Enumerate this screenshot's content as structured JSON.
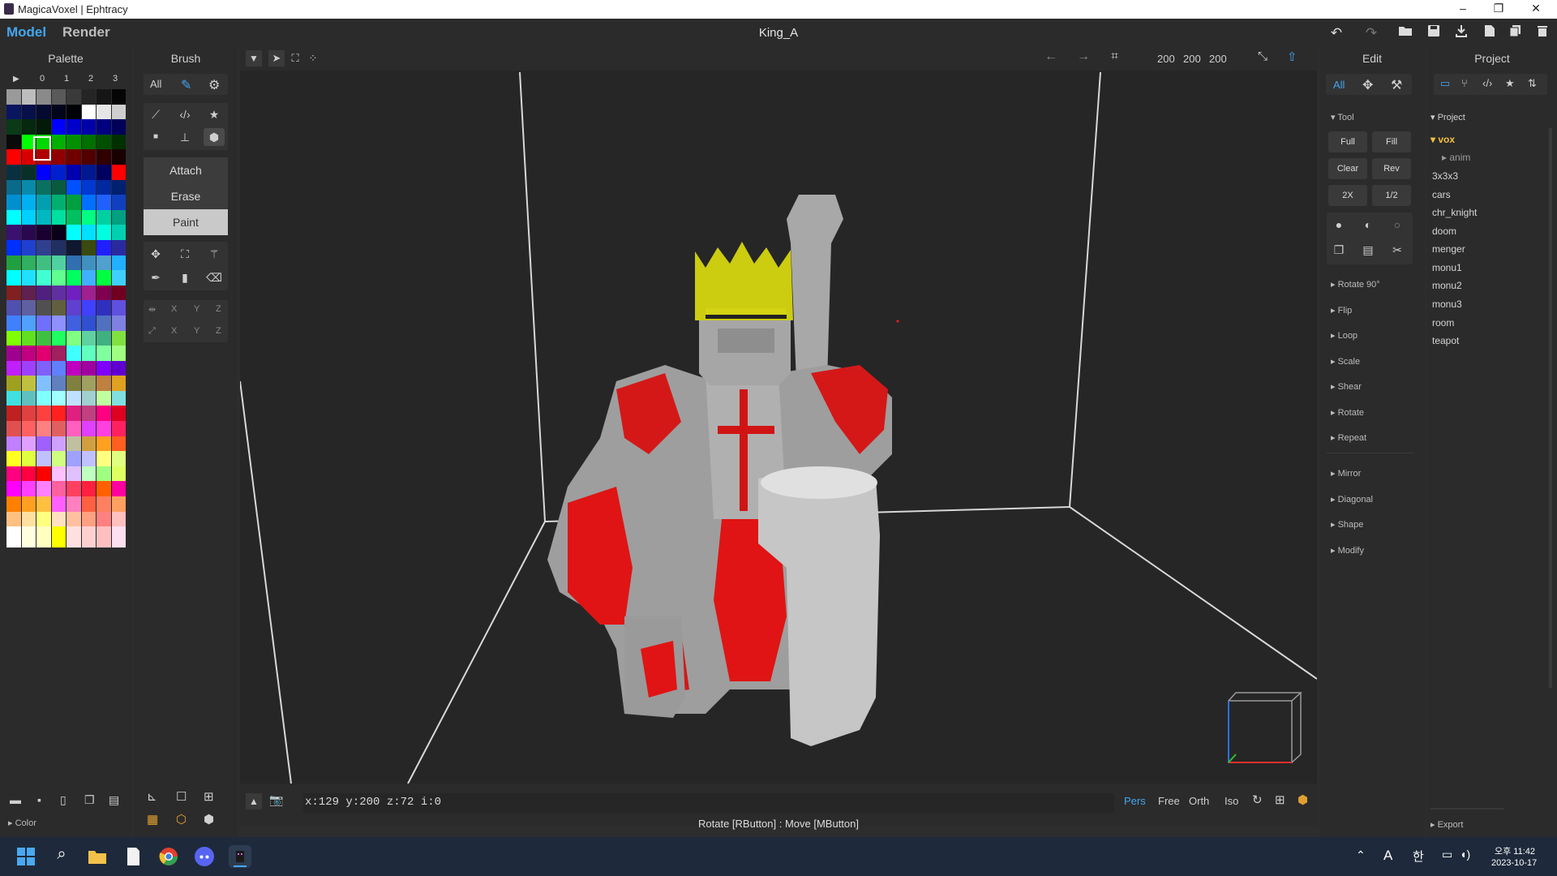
{
  "window": {
    "title": "MagicaVoxel | Ephtracy",
    "minimize": "–",
    "restore": "❐",
    "close": "✕"
  },
  "topbar": {
    "mode_model": "Model",
    "mode_render": "Render",
    "filename": "King_A"
  },
  "palette": {
    "title": "Palette",
    "pages": [
      "0",
      "1",
      "2",
      "3"
    ],
    "footer_label": "Color",
    "colors": [
      "#9a9a9a",
      "#bdbdbd",
      "#8a8a8a",
      "#5a5a5a",
      "#3a3a3a",
      "#252525",
      "#161616",
      "#050505",
      "#0a1560",
      "#08104a",
      "#050a30",
      "#03061a",
      "#010208",
      "#ffffff",
      "#e6e6e6",
      "#cfcfcf",
      "#0a3a18",
      "#06280f",
      "#041a08",
      "#0000ff",
      "#0000cc",
      "#0000a8",
      "#000080",
      "#00005a",
      "#0a0a0a",
      "#00ff00",
      "#00d800",
      "#00b000",
      "#009000",
      "#007000",
      "#005000",
      "#003000",
      "#ff0000",
      "#d80000",
      "#b00000",
      "#900000",
      "#700000",
      "#500000",
      "#300000",
      "#180000",
      "#0a3040",
      "#083028",
      "#0000ff",
      "#0020d0",
      "#0000b0",
      "#001890",
      "#000060",
      "#ff0000",
      "#0a6a8a",
      "#0a8aaa",
      "#0a7060",
      "#0a5a40",
      "#0050ff",
      "#0038d0",
      "#0028a0",
      "#002070",
      "#0090d0",
      "#00b0f0",
      "#00a0b0",
      "#00b070",
      "#00a040",
      "#0070ff",
      "#2060ff",
      "#1040c0",
      "#00ffff",
      "#00d0ff",
      "#00b8c0",
      "#00e0a0",
      "#00c060",
      "#00ff80",
      "#00d0a0",
      "#00a080",
      "#3a1070",
      "#2a0850",
      "#1a0030",
      "#0a0018",
      "#00ffff",
      "#00e0ff",
      "#00ffe0",
      "#00d0b0",
      "#0030ff",
      "#2040d0",
      "#304090",
      "#203060",
      "#101830",
      "#3a4a10",
      "#2020ff",
      "#2a2aa0",
      "#20a040",
      "#30b060",
      "#40c080",
      "#50d0a0",
      "#3070b0",
      "#4090c0",
      "#50a0d0",
      "#20b0ff",
      "#00ffff",
      "#20e0ff",
      "#40ffd0",
      "#60ff90",
      "#00ff60",
      "#40b0ff",
      "#00ff40",
      "#40d0ff",
      "#802020",
      "#602050",
      "#502080",
      "#6030a0",
      "#7020c0",
      "#a02090",
      "#800050",
      "#700020",
      "#5050b0",
      "#6060a0",
      "#505050",
      "#606040",
      "#6040d0",
      "#4040ff",
      "#3030c0",
      "#6050e0",
      "#4080ff",
      "#50a0ff",
      "#7070ff",
      "#9090ff",
      "#4060e0",
      "#3050d0",
      "#5070c0",
      "#8080e0",
      "#80ff00",
      "#60e020",
      "#40c040",
      "#20ff60",
      "#80ff80",
      "#60d0a0",
      "#40b080",
      "#80e040",
      "#a00090",
      "#c00080",
      "#e00070",
      "#a02060",
      "#40ffff",
      "#60ffc0",
      "#80ffa0",
      "#a0ff80",
      "#c020ff",
      "#a040ff",
      "#8060ff",
      "#6080ff",
      "#c000c0",
      "#a000a0",
      "#8000ff",
      "#6000d0",
      "#a0a020",
      "#c0c040",
      "#80c0ff",
      "#6080c0",
      "#808040",
      "#a0a060",
      "#c08040",
      "#e0a020",
      "#40e0e0",
      "#60c0c0",
      "#80ffff",
      "#a0ffff",
      "#c0e0ff",
      "#a0d0d0",
      "#c0ffa0",
      "#80e0e0",
      "#c02020",
      "#e04040",
      "#ff4040",
      "#ff2020",
      "#e02080",
      "#c04080",
      "#ff0080",
      "#e00020",
      "#e05050",
      "#ff6060",
      "#ff8080",
      "#e06060",
      "#ff60c0",
      "#e040ff",
      "#ff40e0",
      "#ff2060",
      "#c080ff",
      "#e0a0ff",
      "#a060ff",
      "#d0a0ff",
      "#c0c0a0",
      "#d0a040",
      "#ffa020",
      "#ff6020",
      "#ffff20",
      "#e0ff40",
      "#c0c0ff",
      "#d0ff80",
      "#a0a0ff",
      "#c0c0ff",
      "#ffff80",
      "#e0ff80",
      "#ff0080",
      "#ff0040",
      "#ff0000",
      "#ffc0ff",
      "#e0c0ff",
      "#c0ffc0",
      "#a0ff80",
      "#e0ff60",
      "#ff00ff",
      "#ff40ff",
      "#ff80ff",
      "#ff60a0",
      "#ff4060",
      "#ff2040",
      "#ff6000",
      "#ff00a0",
      "#ff8000",
      "#ffa020",
      "#ffc040",
      "#ff60ff",
      "#ff80c0",
      "#ff6040",
      "#ff8060",
      "#ffa060",
      "#ffc080",
      "#ffe0a0",
      "#ffff80",
      "#ffe0c0",
      "#ffc0a0",
      "#ffa080",
      "#ff8080",
      "#ffc0c0",
      "#ffffff",
      "#ffffe0",
      "#ffffc0",
      "#ffff00",
      "#ffe0e0",
      "#ffd0d0",
      "#ffc0c0",
      "#ffe0f0"
    ]
  },
  "brush": {
    "title": "Brush",
    "filter_all": "All",
    "modes": [
      "Attach",
      "Erase",
      "Paint"
    ],
    "axes1": [
      "X",
      "Y",
      "Z"
    ],
    "axes2": [
      "X",
      "Y",
      "Z"
    ]
  },
  "viewport": {
    "dims": [
      "200",
      "200",
      "200"
    ],
    "coords": "x:129 y:200 z:72   i:0",
    "views": [
      "Pers",
      "Free",
      "Orth",
      "Iso"
    ],
    "active_view": "Pers",
    "hint": "Rotate [RButton] : Move [MButton]"
  },
  "edit": {
    "title": "Edit",
    "filter_all": "All",
    "tool_section": "Tool",
    "tool_buttons": [
      [
        "Full",
        "Fill"
      ],
      [
        "Clear",
        "Rev"
      ],
      [
        "2X",
        "1/2"
      ]
    ],
    "sections": [
      "Rotate 90°",
      "Flip",
      "Loop",
      "Scale",
      "Shear",
      "Rotate",
      "Repeat"
    ],
    "sections2": [
      "Mirror",
      "Diagonal",
      "Shape",
      "Modify"
    ]
  },
  "project": {
    "title": "Project",
    "root": "Project",
    "folder": "vox",
    "subfolder": "anim",
    "files": [
      "3x3x3",
      "cars",
      "chr_knight",
      "doom",
      "menger",
      "monu1",
      "monu2",
      "monu3",
      "room",
      "teapot"
    ],
    "export": "Export"
  },
  "taskbar": {
    "clock_time": "오후 11:42",
    "clock_date": "2023-10-17",
    "ime1": "A",
    "ime2": "한"
  }
}
